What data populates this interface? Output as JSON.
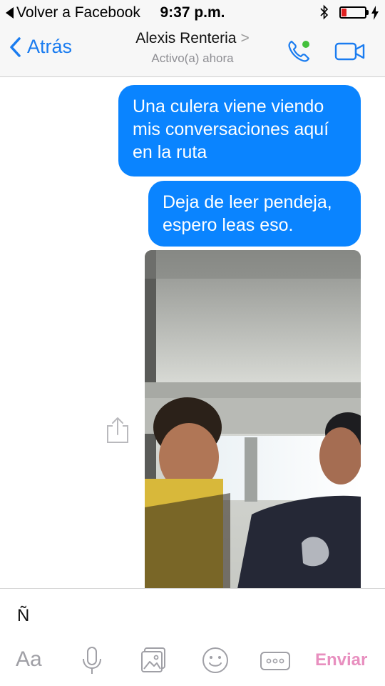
{
  "status_bar": {
    "back_label": "Volver a Facebook",
    "time": "9:37 p.m.",
    "battery_color": "#e02020"
  },
  "header": {
    "back_label": "Atrás",
    "contact_name": "Alexis Renteria",
    "contact_chevron": ">",
    "contact_status": "Activo(a) ahora",
    "accent_color": "#1a7cf0",
    "online_dot_color": "#44c03c"
  },
  "messages": [
    {
      "direction": "outgoing",
      "type": "text",
      "text": "Una culera viene viendo mis conversaciones aquí en la ruta"
    },
    {
      "direction": "outgoing",
      "type": "text",
      "text": "Deja de leer pendeja, espero leas eso."
    },
    {
      "direction": "outgoing",
      "type": "image",
      "icon": "share-icon"
    }
  ],
  "bubble_color": "#0a84ff",
  "composer": {
    "typed_text": "Ñ",
    "aa_label": "Aa",
    "send_label": "Enviar",
    "send_color": "#e88fbf",
    "icons": [
      "microphone-icon",
      "gallery-icon",
      "emoji-icon",
      "more-icon"
    ]
  }
}
